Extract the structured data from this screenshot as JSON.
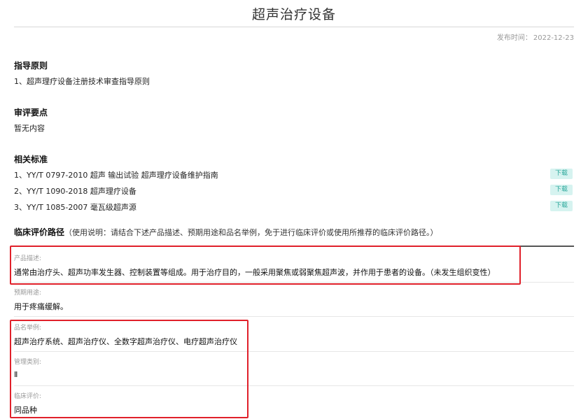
{
  "title": "超声治疗设备",
  "publish": {
    "label": "发布时间：",
    "date": "2022-12-23"
  },
  "guidance": {
    "heading": "指导原则",
    "items": [
      "1、超声理疗设备注册技术审查指导原则"
    ]
  },
  "review": {
    "heading": "审评要点",
    "content": "暂无内容"
  },
  "standards": {
    "heading": "相关标准",
    "download_label": "下载",
    "items": [
      "1、YY/T 0797-2010 超声 输出试验 超声理疗设备维护指南",
      "2、YY/T 1090-2018 超声理疗设备",
      "3、YY/T 1085-2007 毫瓦级超声源"
    ]
  },
  "clinical": {
    "heading": "临床评价路径",
    "note": "（使用说明：请结合下述产品描述、预期用途和品名举例，免于进行临床评价或使用所推荐的临床评价路径。）",
    "fields": {
      "description": {
        "label": "产品描述:",
        "value": "通常由治疗头、超声功率发生器、控制装置等组成。用于治疗目的，一般采用聚焦或弱聚焦超声波，并作用于患者的设备。（未发生组织变性）"
      },
      "intended_use": {
        "label": "预期用途:",
        "value": "用于疼痛缓解。"
      },
      "examples": {
        "label": "品名举例:",
        "value": "超声治疗系统、超声治疗仪、全数字超声治疗仪、电疗超声治疗仪"
      },
      "class": {
        "label": "管理类别:",
        "value": "Ⅱ"
      },
      "evaluation": {
        "label": "临床评价:",
        "value": "同品种"
      }
    }
  },
  "highlight_color": "#e0202a"
}
